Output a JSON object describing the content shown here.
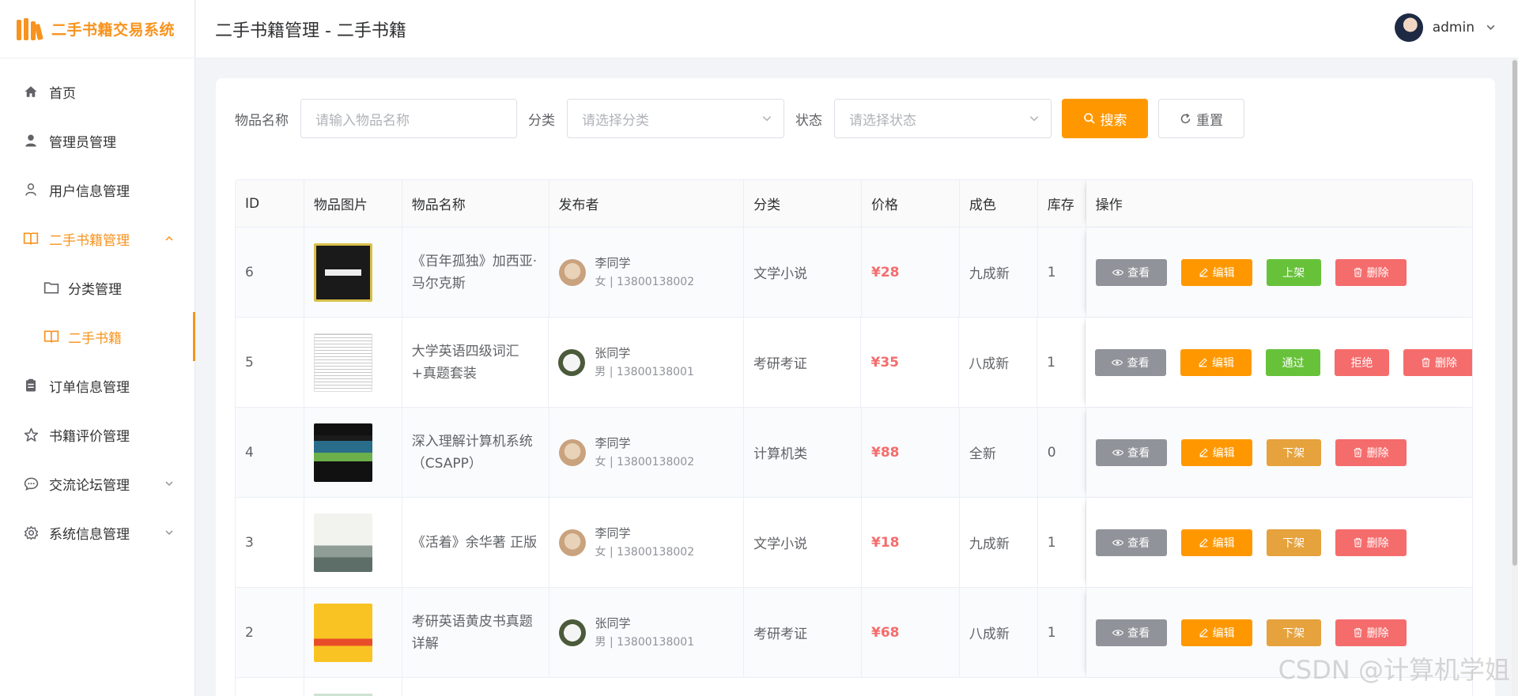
{
  "app": {
    "logo_text": "二手书籍交易系统"
  },
  "header": {
    "title": "二手书籍管理 - 二手书籍",
    "username": "admin"
  },
  "sidebar": {
    "items": [
      {
        "label": "首页",
        "icon": "home-icon"
      },
      {
        "label": "管理员管理",
        "icon": "user-solid-icon"
      },
      {
        "label": "用户信息管理",
        "icon": "user-icon"
      },
      {
        "label": "二手书籍管理",
        "icon": "book-icon",
        "expanded": true,
        "children": [
          {
            "label": "分类管理",
            "icon": "folder-icon"
          },
          {
            "label": "二手书籍",
            "icon": "book-icon",
            "active": true
          }
        ]
      },
      {
        "label": "订单信息管理",
        "icon": "clipboard-icon"
      },
      {
        "label": "书籍评价管理",
        "icon": "star-icon"
      },
      {
        "label": "交流论坛管理",
        "icon": "chat-icon"
      },
      {
        "label": "系统信息管理",
        "icon": "gear-icon"
      }
    ]
  },
  "filters": {
    "name_label": "物品名称",
    "name_placeholder": "请输入物品名称",
    "category_label": "分类",
    "category_placeholder": "请选择分类",
    "status_label": "状态",
    "status_placeholder": "请选择状态",
    "search_button": "搜索",
    "reset_button": "重置"
  },
  "table": {
    "columns": [
      "ID",
      "物品图片",
      "物品名称",
      "发布者",
      "分类",
      "价格",
      "成色",
      "库存",
      "操作"
    ],
    "rows": [
      {
        "id": "6",
        "name": "《百年孤独》加西亚·马尔克斯",
        "publisher": "李同学",
        "publisher_meta": "女 | 13800138002",
        "category": "文学小说",
        "price": "¥28",
        "condition": "九成新",
        "stock": "1",
        "actions": [
          "查看",
          "编辑",
          "上架",
          "删除"
        ]
      },
      {
        "id": "5",
        "name": "大学英语四级词汇+真题套装",
        "publisher": "张同学",
        "publisher_meta": "男 | 13800138001",
        "category": "考研考证",
        "price": "¥35",
        "condition": "八成新",
        "stock": "1",
        "actions": [
          "查看",
          "编辑",
          "通过",
          "拒绝",
          "删除"
        ]
      },
      {
        "id": "4",
        "name": "深入理解计算机系统（CSAPP）",
        "publisher": "李同学",
        "publisher_meta": "女 | 13800138002",
        "category": "计算机类",
        "price": "¥88",
        "condition": "全新",
        "stock": "0",
        "actions": [
          "查看",
          "编辑",
          "下架",
          "删除"
        ]
      },
      {
        "id": "3",
        "name": "《活着》余华著 正版",
        "publisher": "李同学",
        "publisher_meta": "女 | 13800138002",
        "category": "文学小说",
        "price": "¥18",
        "condition": "九成新",
        "stock": "1",
        "actions": [
          "查看",
          "编辑",
          "下架",
          "删除"
        ]
      },
      {
        "id": "2",
        "name": "考研英语黄皮书真题详解",
        "publisher": "张同学",
        "publisher_meta": "男 | 13800138001",
        "category": "考研考证",
        "price": "¥68",
        "condition": "八成新",
        "stock": "1",
        "actions": [
          "查看",
          "编辑",
          "下架",
          "删除"
        ]
      }
    ]
  },
  "watermark": "CSDN @计算机学姐",
  "colors": {
    "accent": "#f7931e",
    "primary_button": "#ff9800",
    "price": "#f56c6c",
    "success": "#67c23a",
    "warning": "#e6a23c",
    "info": "#909399"
  }
}
